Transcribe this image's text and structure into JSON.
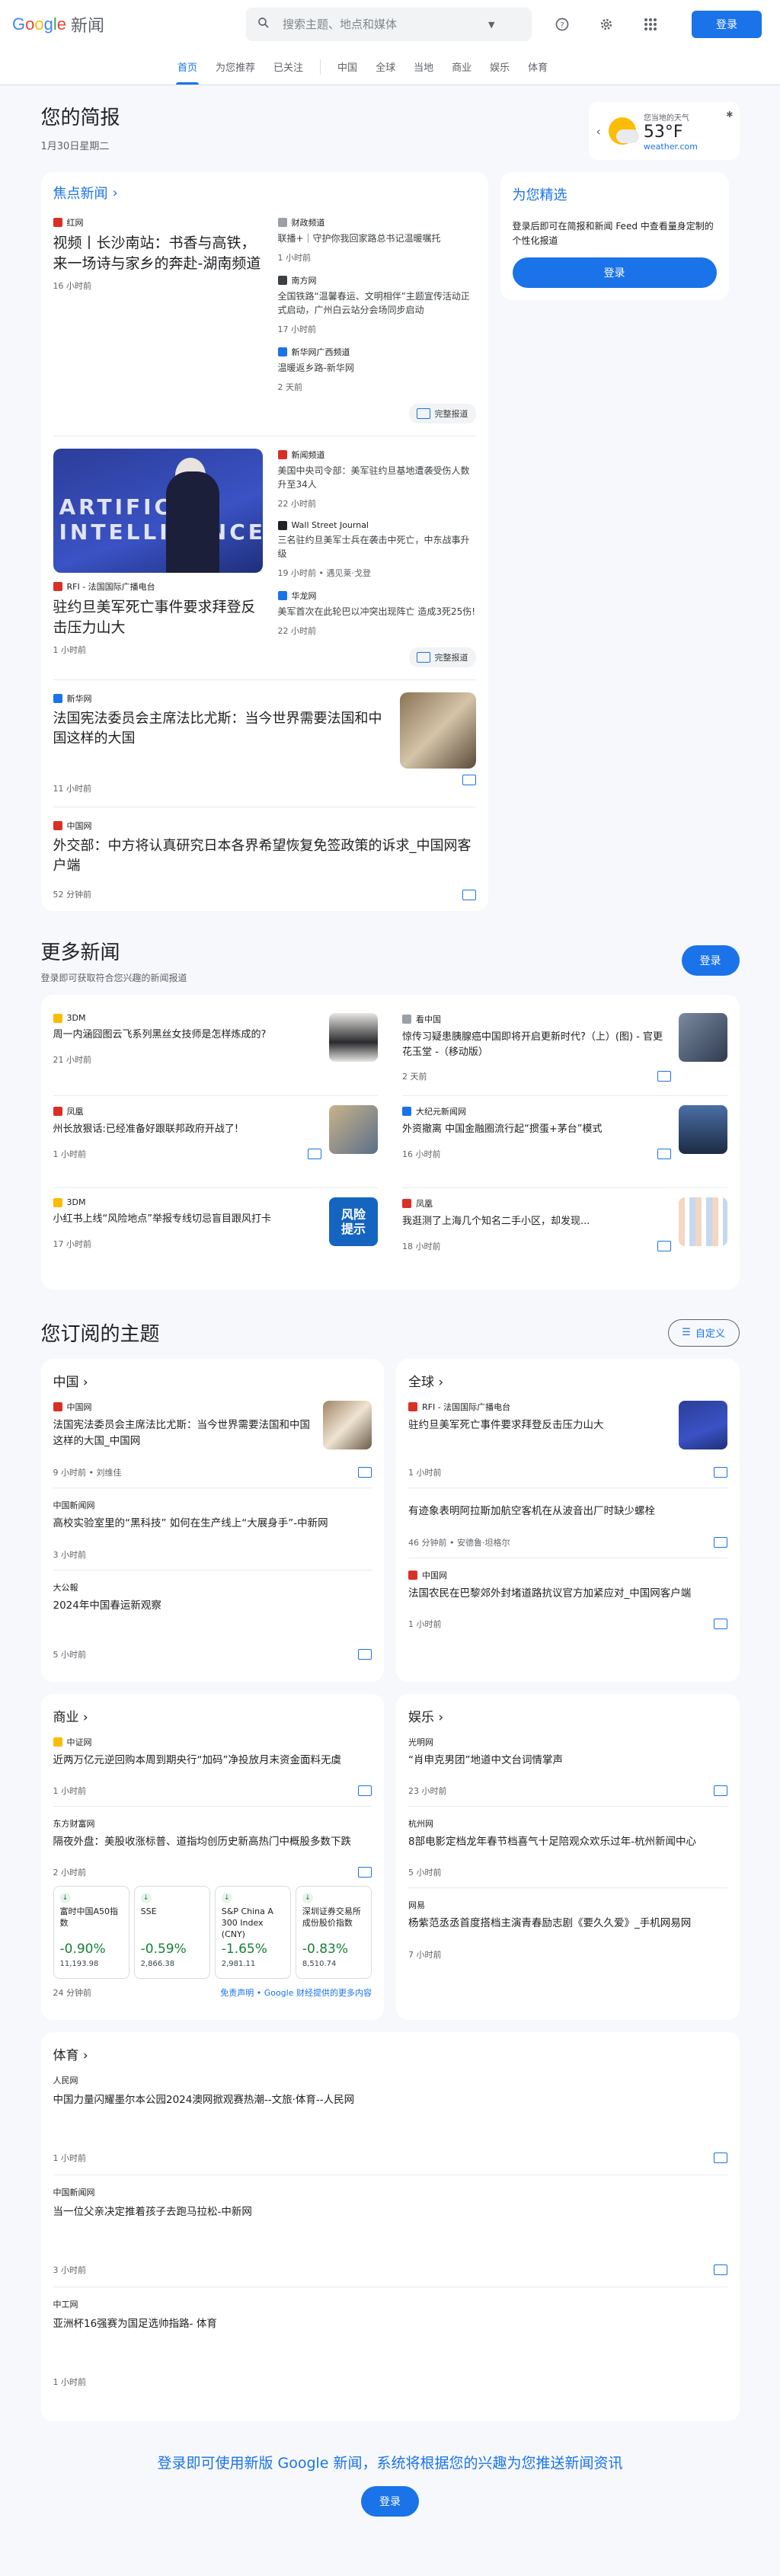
{
  "header": {
    "logo_google": "Google",
    "logo_news": "新闻",
    "search_placeholder": "搜索主题、地点和媒体",
    "login": "登录"
  },
  "nav": {
    "tabs": [
      "首页",
      "为您推荐",
      "已关注"
    ],
    "sections": [
      "中国",
      "全球",
      "当地",
      "商业",
      "娱乐",
      "体育"
    ]
  },
  "briefing": {
    "title": "您的简报",
    "date": "1月30日星期二"
  },
  "weather": {
    "label": "您当地的天气",
    "temp": "53°F",
    "source": "weather.com"
  },
  "top": {
    "heading": "焦点新闻",
    "full_coverage": "完整报道",
    "cluster1": {
      "main": {
        "source": "红网",
        "title": "视频丨长沙南站：书香与高铁，来一场诗与家乡的奔赴-湖南频道",
        "time": "16 小时前"
      },
      "subs": [
        {
          "source": "财政频道",
          "title": "联播+｜守护你我回家路总书记温暖嘱托",
          "time": "1 小时前"
        },
        {
          "source": "南方网",
          "title": "全国铁路“温馨春运、文明相伴”主题宣传活动正式启动，广州白云站分会场同步启动",
          "time": "17 小时前"
        },
        {
          "source": "新华网广西频道",
          "title": "温暖返乡路-新华网",
          "time": "2 天前"
        }
      ]
    },
    "cluster2": {
      "main": {
        "source": "RFI - 法国国际广播电台",
        "title": "驻约旦美军死亡事件要求拜登反击压力山大",
        "time": "1 小时前",
        "image_text": "ARTIFICIAL INTELLIGENCE"
      },
      "subs": [
        {
          "source": "新闻频道",
          "title": "美国中央司令部：美军驻约旦基地遭袭受伤人数升至34人",
          "time": "22 小时前"
        },
        {
          "source": "Wall Street Journal",
          "title": "三名驻约旦美军士兵在袭击中死亡，中东战事升级",
          "time": "19 小时前 • 遇见莱·戈登"
        },
        {
          "source": "华龙网",
          "title": "美军首次在此轮巴以冲突出现阵亡 造成3死25伤!",
          "time": "22 小时前"
        }
      ]
    },
    "story3": {
      "source": "新华网",
      "title": "法国宪法委员会主席法比尤斯：当今世界需要法国和中国这样的大国",
      "time": "11 小时前"
    },
    "story4": {
      "source": "中国网",
      "title": "外交部：中方将认真研究日本各界希望恢复免签政策的诉求_中国网客户端",
      "time": "52 分钟前"
    }
  },
  "picks": {
    "title": "为您精选",
    "desc": "登录后即可在简报和新闻 Feed 中查看量身定制的个性化报道",
    "login": "登录"
  },
  "more": {
    "title": "更多新闻",
    "subtitle": "登录即可获取符合您兴趣的新闻报道",
    "login": "登录",
    "items": [
      {
        "source": "3DM",
        "title": "周一内涵囧图云飞系列黑丝女技师是怎样炼成的?",
        "time": "21 小时前"
      },
      {
        "source": "看中国",
        "title": "惊传习疑患胰腺癌中国即将开启更新时代?（上）(图) - 官更花玉堂 -（移动版）",
        "time": "2 天前"
      },
      {
        "source": "凤凰",
        "title": "州长放狠话:已经准备好跟联邦政府开战了!",
        "time": "1 小时前"
      },
      {
        "source": "大纪元新闻网",
        "title": "外资撤离 中国金融圈流行起“掼蛋+茅台”模式",
        "time": "16 小时前"
      },
      {
        "source": "3DM",
        "title": "小红书上线“风险地点”举报专线切忌盲目跟风打卡",
        "time": "17 小时前"
      },
      {
        "source": "凤凰",
        "title": "我逛测了上海几个知名二手小区，却发现...",
        "time": "18 小时前"
      }
    ]
  },
  "topics": {
    "title": "您订阅的主题",
    "customize": "自定义",
    "china": {
      "title": "中国",
      "stories": [
        {
          "source": "中国网",
          "title": "法国宪法委员会主席法比尤斯：当今世界需要法国和中国这样的大国_中国网",
          "time": "9 小时前 • 刘维佳"
        },
        {
          "source": "中国新闻网",
          "title": "高校实验室里的“黑科技” 如何在生产线上“大展身手”-中新网",
          "time": "3 小时前"
        },
        {
          "source": "大公報",
          "title": "2024年中国春运新观察",
          "time": "5 小时前"
        }
      ]
    },
    "world": {
      "title": "全球",
      "stories": [
        {
          "source": "RFI - 法国国际广播电台",
          "title": "驻约旦美军死亡事件要求拜登反击压力山大",
          "time": "1 小时前"
        },
        {
          "source": "",
          "title": "有迹象表明阿拉斯加航空客机在从波音出厂时缺少螺栓",
          "time": "46 分钟前 • 安德鲁·坦格尔"
        },
        {
          "source": "中国网",
          "title": "法国农民在巴黎郊外封堵道路抗议官方加紧应对_中国网客户端",
          "time": "1 小时前"
        }
      ]
    },
    "business": {
      "title": "商业",
      "stories": [
        {
          "source": "中证网",
          "title": "近两万亿元逆回购本周到期央行“加码”净投放月末资金面料无虞",
          "time": "1 小时前"
        },
        {
          "source": "东方财富网",
          "title": "隔夜外盘：美股收涨标普、道指均创历史新高热门中概股多数下跌",
          "time": "2 小时前"
        }
      ],
      "stocks": [
        {
          "name": "富时中国A50指数",
          "pct": "-0.90%",
          "val": "11,193.98"
        },
        {
          "name": "SSE",
          "pct": "-0.59%",
          "val": "2,866.38"
        },
        {
          "name": "S&P China A 300 Index (CNY)",
          "pct": "-1.65%",
          "val": "2,981.11"
        },
        {
          "name": "深圳证券交易所成份股价指数",
          "pct": "-0.83%",
          "val": "8,510.74"
        }
      ],
      "stock_time": "24 分钟前",
      "disclaimer": "免责声明 • Google 财经提供的更多内容"
    },
    "ent": {
      "title": "娱乐",
      "stories": [
        {
          "source": "光明网",
          "title": "“肖申克男团”地道中文台词情掌声",
          "time": "23 小时前"
        },
        {
          "source": "杭州网",
          "title": "8部电影定档龙年春节档喜气十足陪观众欢乐过年-杭州新闻中心",
          "time": "5 小时前"
        },
        {
          "source": "网易",
          "title": "杨紫范丞丞首度搭档主演青春励志剧《要久久爱》_手机网易网",
          "time": "7 小时前"
        }
      ]
    },
    "sports": {
      "title": "体育",
      "stories": [
        {
          "source": "人民网",
          "title": "中国力量闪耀墨尔本公园2024澳网掀观赛热潮--文旅·体育--人民网",
          "time": "1 小时前"
        },
        {
          "source": "中国新闻网",
          "title": "当一位父亲决定推着孩子去跑马拉松-中新网",
          "time": "3 小时前"
        },
        {
          "source": "中工网",
          "title": "亚洲杯16强赛为国足选帅指路- 体育",
          "time": "1 小时前"
        }
      ]
    }
  },
  "footer": {
    "text": "登录即可使用新版 Google 新闻，系统将根据您的兴趣为您推送新闻资讯",
    "login": "登录"
  }
}
